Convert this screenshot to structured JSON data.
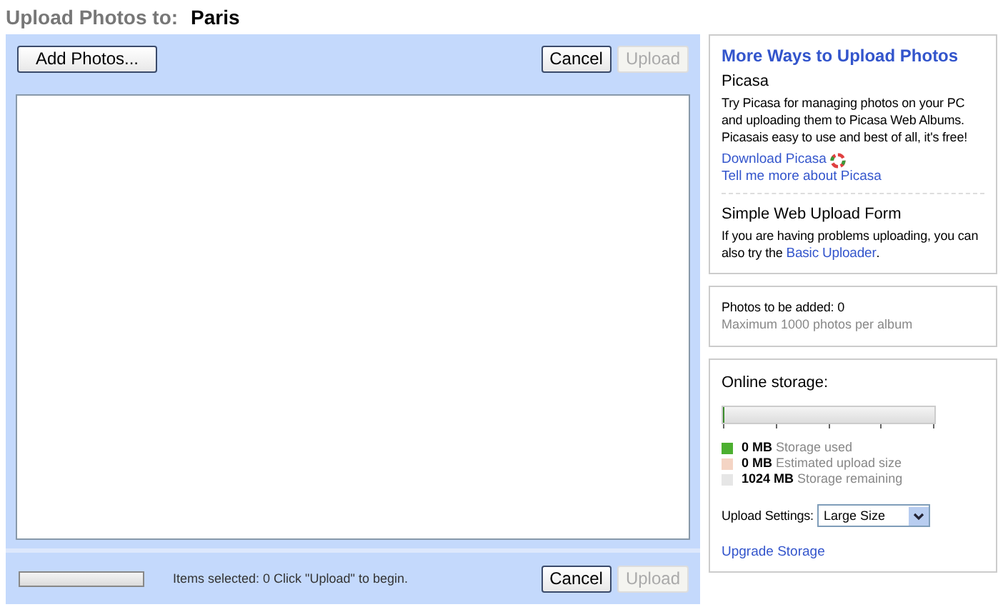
{
  "header": {
    "label": "Upload Photos to:",
    "album": "Paris"
  },
  "toolbar": {
    "add_button": "Add Photos...",
    "buttons": [
      {
        "label": "Cancel",
        "disabled": false
      },
      {
        "label": "Upload",
        "disabled": true
      }
    ]
  },
  "footer": {
    "progress": {
      "level": 0
    },
    "status": "Items selected: 0 Click \"Upload\" to begin.",
    "buttons": [
      {
        "label": "Cancel",
        "disabled": false
      },
      {
        "label": "Upload",
        "disabled": true
      }
    ]
  },
  "more_ways": {
    "title": "More Ways to Upload Photos",
    "picasa_heading": "Picasa",
    "picasa_text": "Try Picasa for managing photos on your PC and uploading them to Picasa Web Albums. Picasais easy to use and best of all, it's free!",
    "download_link": "Download Picasa",
    "tell_link": "Tell me more about Picasa",
    "simple_heading": "Simple Web Upload Form",
    "simple_text": "If you are having problems uploading, you can also try the",
    "simple_link": "Basic Uploader",
    "simple_end": "."
  },
  "photos": {
    "count": "Photos to be added: 0",
    "max": "Maximum 1000 photos per album"
  },
  "storage": {
    "title": "Online storage:",
    "level": 0.01,
    "legend": [
      {
        "amount": "0 MB",
        "label": "Storage used",
        "color": "#4caf30"
      },
      {
        "amount": "0 MB",
        "label": "Estimated upload size",
        "color": "#f4d4c4"
      },
      {
        "amount": "1024 MB",
        "label": "Storage remaining",
        "color": "#e6e6e6"
      }
    ],
    "settings_label": "Upload Settings:",
    "settings_value": "Large Size",
    "upgrade_link": "Upgrade Storage"
  }
}
